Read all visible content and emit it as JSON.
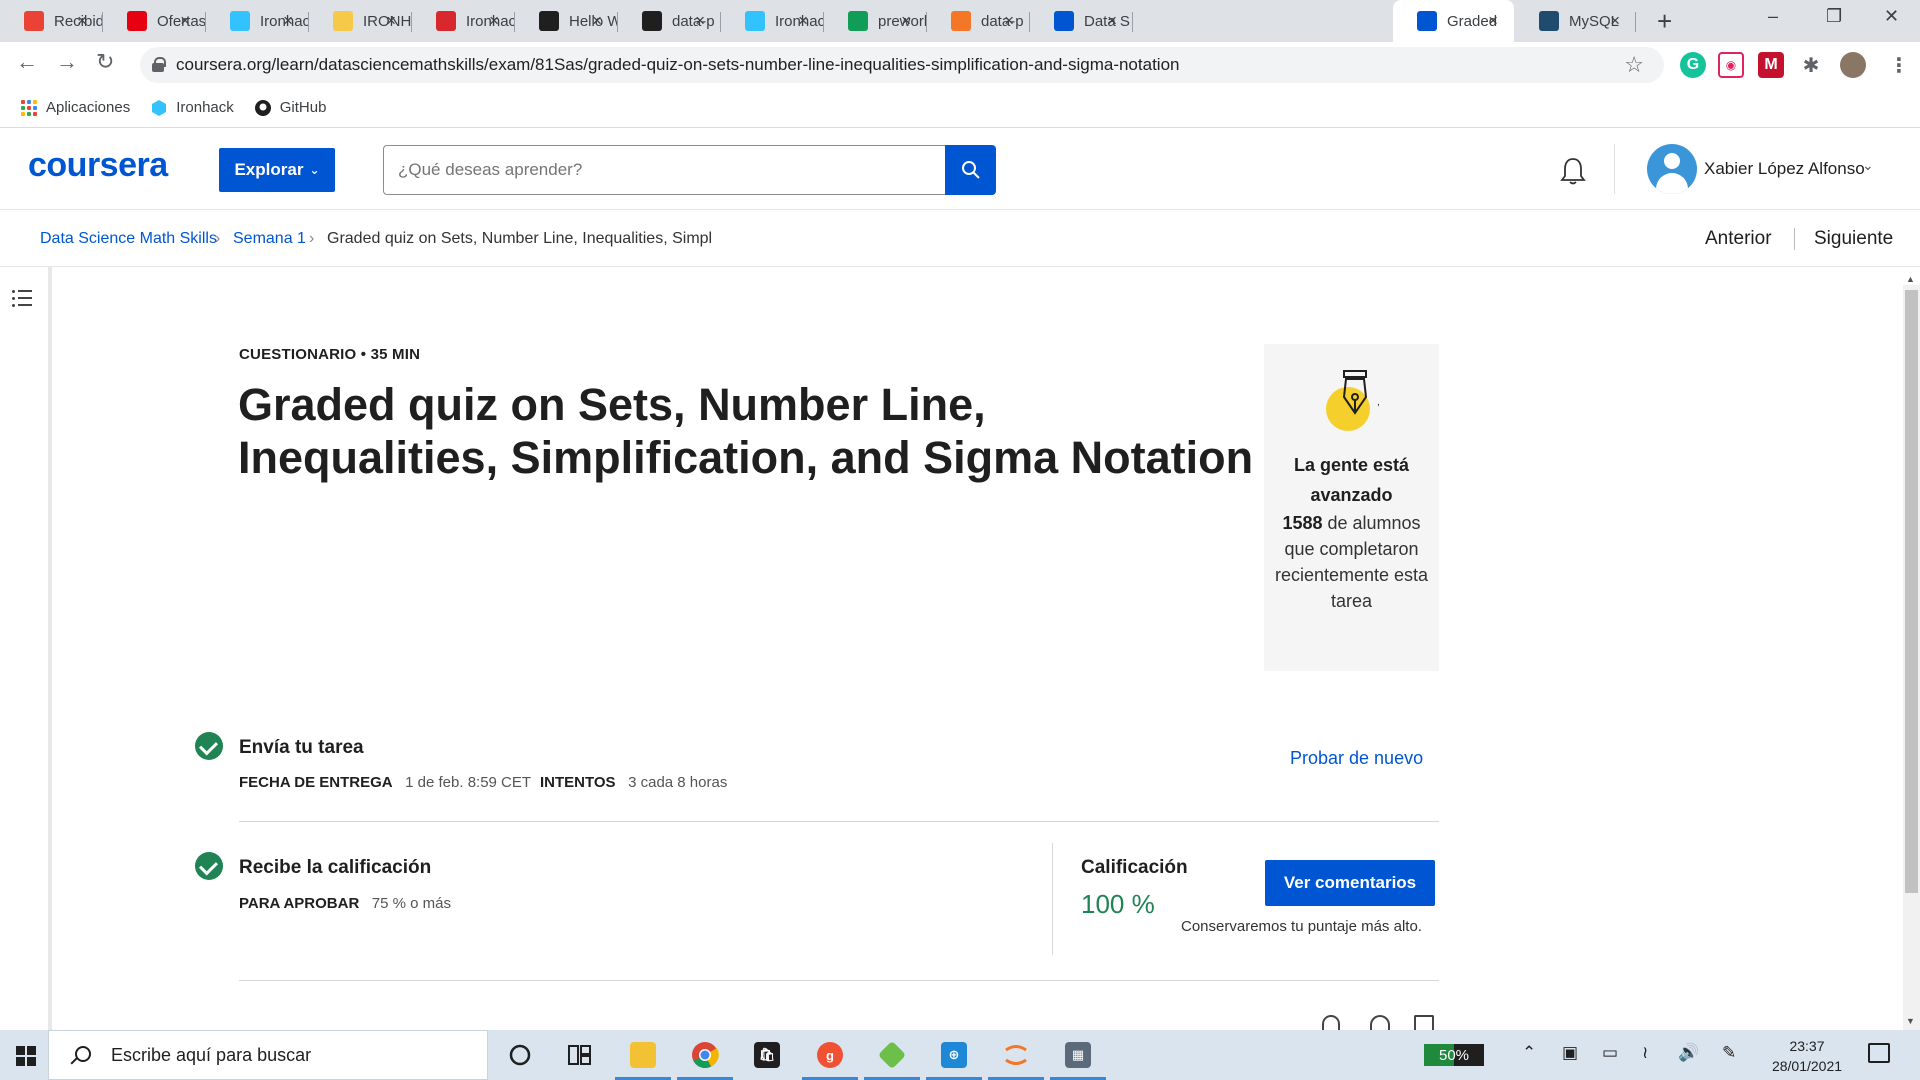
{
  "browser": {
    "tabs": [
      {
        "title": "Recibid",
        "icon": "gmail-icon",
        "color": "#ea4335"
      },
      {
        "title": "Ofertas",
        "icon": "uniqlo-icon",
        "color": "#e60012"
      },
      {
        "title": "Ironhack",
        "icon": "ironhack-icon",
        "color": "#32c3ff"
      },
      {
        "title": "IRONHACK",
        "icon": "ironhack-hand-icon",
        "color": "#f7c948"
      },
      {
        "title": "Ironhack",
        "icon": "miro-icon",
        "color": "#d9272e"
      },
      {
        "title": "Hello W",
        "icon": "github-icon",
        "color": "#1f1f1f"
      },
      {
        "title": "data-p",
        "icon": "github-icon",
        "color": "#1f1f1f"
      },
      {
        "title": "Ironhack",
        "icon": "ironhack-icon",
        "color": "#32c3ff"
      },
      {
        "title": "prework",
        "icon": "sheets-icon",
        "color": "#0f9d58"
      },
      {
        "title": "data-p",
        "icon": "jupyter-icon",
        "color": "#f37726"
      },
      {
        "title": "Data S",
        "icon": "coursera-icon",
        "color": "#0056d2"
      },
      {
        "title": "Graded",
        "icon": "coursera-icon",
        "color": "#0056d2",
        "active": true
      },
      {
        "title": "MySQL",
        "icon": "mysql-icon",
        "color": "#1f4b6e"
      }
    ],
    "url": "coursera.org/learn/datasciencemathskills/exam/81Sas/graded-quiz-on-sets-number-line-inequalities-simplification-and-sigma-notation",
    "bookmarks": [
      {
        "label": "Aplicaciones",
        "icon": "apps-grid-icon"
      },
      {
        "label": "Ironhack",
        "icon": "ironhack-icon"
      },
      {
        "label": "GitHub",
        "icon": "github-icon"
      }
    ]
  },
  "header": {
    "logo": "coursera",
    "explore_label": "Explorar",
    "search_placeholder": "¿Qué deseas aprender?",
    "user_name": "Xabier López Alfonso"
  },
  "breadcrumb": {
    "course": "Data Science Math Skills",
    "week": "Semana 1",
    "item": "Graded quiz on Sets, Number Line, Inequalities, Simpl",
    "prev_label": "Anterior",
    "next_label": "Siguiente"
  },
  "quiz": {
    "kicker": "CUESTIONARIO • 35 MIN",
    "title": "Graded quiz on Sets, Number Line, Inequalities, Simplification, and Sigma Notation",
    "stat_heading": "La gente está avanzado",
    "stat_count": "1588",
    "stat_text": "de alumnos que completaron recientemente esta tarea",
    "submit": {
      "title": "Envía tu tarea",
      "due_label": "FECHA DE ENTREGA",
      "due_value": "1 de feb. 8:59 CET",
      "attempts_label": "INTENTOS",
      "attempts_value": "3 cada 8 horas",
      "retry_label": "Probar de nuevo"
    },
    "grade": {
      "title": "Recibe la calificación",
      "pass_label": "PARA APROBAR",
      "pass_value": "75 % o más",
      "grade_label": "Calificación",
      "grade_value": "100 %",
      "feedback_label": "Ver comentarios",
      "keep_note": "Conservaremos tu puntaje más alto."
    }
  },
  "taskbar": {
    "search_placeholder": "Escribe aquí para buscar",
    "battery": "50%",
    "battery_level": 0.5,
    "time": "23:37",
    "date": "28/01/2021"
  }
}
